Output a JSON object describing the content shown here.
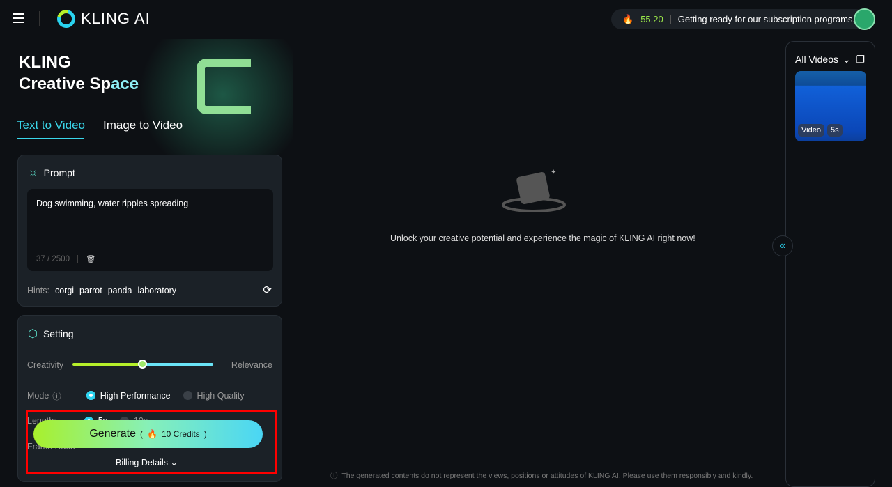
{
  "header": {
    "brand": "KLING AI",
    "credits": "55.20",
    "notice": "Getting ready for our subscription programs."
  },
  "hero": {
    "line1": "KLING",
    "line2a": "Creative Sp",
    "line2b": "ace"
  },
  "tabs": [
    {
      "label": "Text to Video",
      "active": true
    },
    {
      "label": "Image to Video",
      "active": false
    }
  ],
  "prompt": {
    "title": "Prompt",
    "value": "Dog swimming, water ripples spreading",
    "count": "37 / 2500",
    "hints_label": "Hints:",
    "hints": [
      "corgi",
      "parrot",
      "panda",
      "laboratory"
    ]
  },
  "setting": {
    "title": "Setting",
    "slider_left": "Creativity",
    "slider_right": "Relevance",
    "slider_value": 0.5,
    "mode_label": "Mode",
    "mode_options": [
      "High Performance",
      "High Quality"
    ],
    "mode_selected": "High Performance",
    "length_label": "Length:",
    "length_options": [
      "5s",
      "10s"
    ],
    "length_selected": "5s",
    "frame_label": "Frame Ratio"
  },
  "generate": {
    "label": "Generate",
    "credits": "10 Credits",
    "billing": "Billing Details"
  },
  "main": {
    "empty_text": "Unlock your creative potential and experience the magic of KLING AI right now!",
    "disclaimer": "The generated contents do not represent the views, positions or attitudes of KLING AI. Please use them responsibly and kindly."
  },
  "sidebar": {
    "filter": "All Videos",
    "items": [
      {
        "type": "Video",
        "duration": "5s"
      }
    ]
  },
  "colors": {
    "accent": "#3ad7ea",
    "credit": "#9be84a",
    "highlight_box": "#ff0000"
  }
}
